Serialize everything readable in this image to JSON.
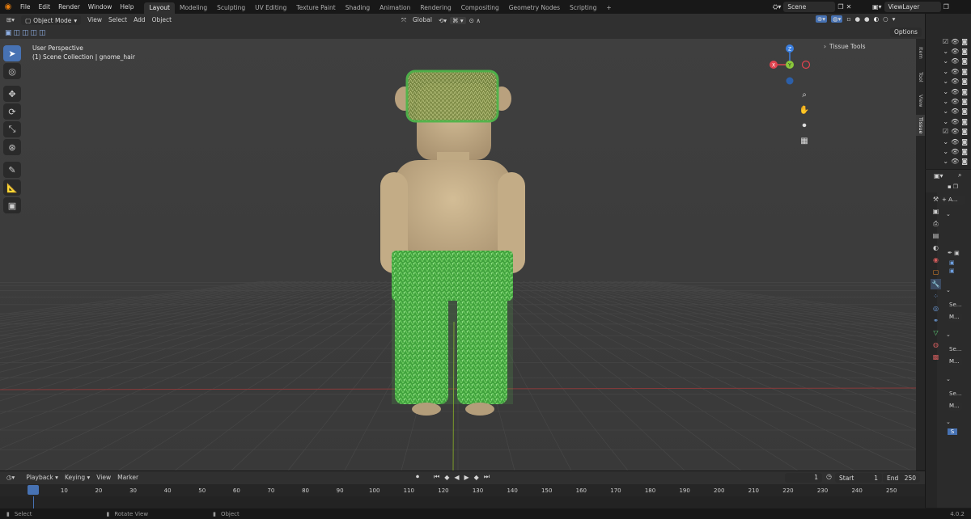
{
  "menu": [
    "File",
    "Edit",
    "Render",
    "Window",
    "Help"
  ],
  "workspace_tabs": [
    "Layout",
    "Modeling",
    "Sculpting",
    "UV Editing",
    "Texture Paint",
    "Shading",
    "Animation",
    "Rendering",
    "Compositing",
    "Geometry Nodes",
    "Scripting"
  ],
  "active_tab": "Layout",
  "add_tab": "+",
  "scene": "Scene",
  "view_layer": "ViewLayer",
  "viewport_header": {
    "mode": "Object Mode",
    "view": "View",
    "select": "Select",
    "add": "Add",
    "object": "Object",
    "orientation": "Global",
    "options": "Options"
  },
  "viewport": {
    "perspective": "User Perspective",
    "collection": "(1) Scene Collection | gnome_hair",
    "tissue_tools": "Tissue Tools",
    "gizmo": {
      "z": "Z",
      "y": "Y",
      "x": "X"
    }
  },
  "side_tabs": [
    "Item",
    "Tool",
    "View",
    "Tissue"
  ],
  "props_labels": [
    "+ A...",
    "Se...",
    "M...",
    "Se...",
    "M...",
    "Se...",
    "M...",
    "S"
  ],
  "timeline": {
    "playback": "Playback",
    "keying": "Keying",
    "view": "View",
    "marker": "Marker",
    "current_frame": "1",
    "start_label": "Start",
    "start": "1",
    "end_label": "End",
    "end": "250",
    "ticks": [
      "1",
      "10",
      "20",
      "30",
      "40",
      "50",
      "60",
      "70",
      "80",
      "90",
      "100",
      "110",
      "120",
      "130",
      "140",
      "150",
      "160",
      "170",
      "180",
      "190",
      "200",
      "210",
      "220",
      "230",
      "240",
      "250"
    ]
  },
  "status": {
    "select": "Select",
    "rotate": "Rotate View",
    "object": "Object",
    "version": "4.0.2"
  },
  "colors": {
    "accent": "#4772b3",
    "skin": "#c7b08b",
    "hair_green": "#4fb54a",
    "hat_green": "#6f8a3a",
    "axis_x": "#e0434f",
    "axis_y": "#8ac73b",
    "axis_z": "#3b7fe0"
  },
  "icons": [
    "blender-logo-icon",
    "select-tool-icon",
    "cursor-tool-icon",
    "move-tool-icon",
    "rotate-tool-icon",
    "scale-tool-icon",
    "transform-tool-icon",
    "annotate-tool-icon",
    "measure-tool-icon",
    "add-cube-tool-icon",
    "zoom-icon",
    "hand-icon",
    "camera-icon",
    "grid-icon",
    "eye-icon",
    "camera-render-icon",
    "checkbox-icon"
  ]
}
